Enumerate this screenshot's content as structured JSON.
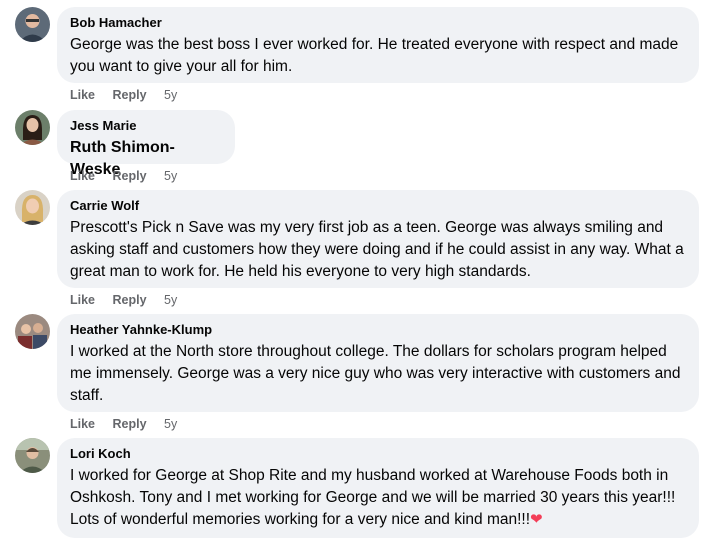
{
  "comments": [
    {
      "author": "Bob Hamacher",
      "text": "George was the best boss I ever worked for. He treated everyone with respect and made you want to give your all for him.",
      "like": "Like",
      "reply": "Reply",
      "time": "5y",
      "avatar": "avatar-man-glasses"
    },
    {
      "author": "Jess Marie",
      "text": "Ruth Shimon-Weske",
      "like": "Like",
      "reply": "Reply",
      "time": "5y",
      "avatar": "avatar-woman-dark-hair"
    },
    {
      "author": "Carrie Wolf",
      "text": "Prescott's Pick n Save was my very first job as a teen. George was always smiling and asking staff and customers how they were doing and if he could assist in any way. What a great man to work for. He held his everyone to very high standards.",
      "like": "Like",
      "reply": "Reply",
      "time": "5y",
      "avatar": "avatar-woman-blonde"
    },
    {
      "author": "Heather Yahnke-Klump",
      "text": "I worked at the North store throughout college. The dollars for scholars program helped me immensely. George was a very nice guy who was very interactive with customers and staff.",
      "like": "Like",
      "reply": "Reply",
      "time": "5y",
      "avatar": "avatar-group-photo"
    },
    {
      "author": "Lori Koch",
      "text": "I worked for George at Shop Rite and my husband worked at Warehouse Foods both in Oshkosh. Tony and I met working for George and we will be married 30 years this year!!! Lots of wonderful memories working for a very nice and kind man!!!",
      "emoji": "❤",
      "avatar": "avatar-woman-outdoor"
    }
  ],
  "colors": {
    "bubble": "#f0f2f5",
    "meta": "#65676b",
    "text": "#050505",
    "heart": "#f33e58"
  }
}
